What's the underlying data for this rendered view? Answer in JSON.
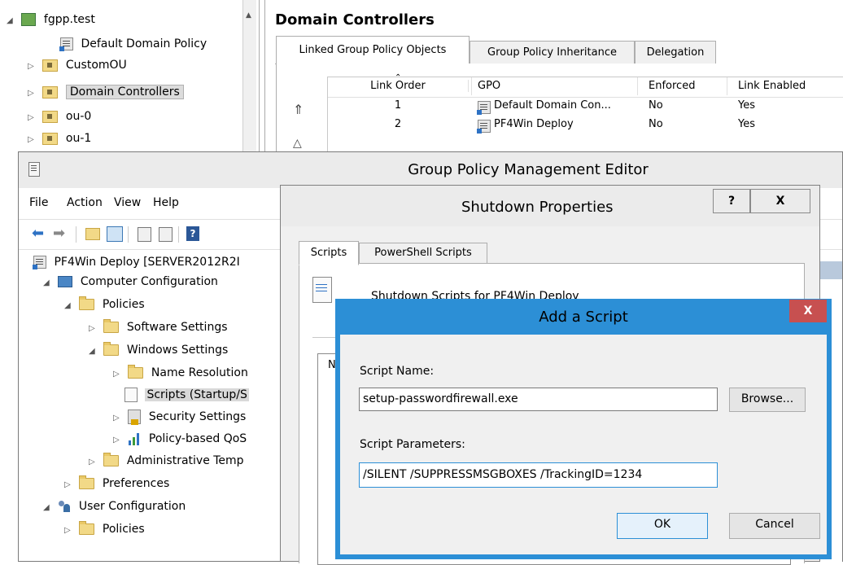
{
  "gpmc": {
    "tree": [
      {
        "label": "fgpp.test"
      },
      {
        "label": "Default Domain Policy"
      },
      {
        "label": "CustomOU"
      },
      {
        "label": "Domain Controllers"
      },
      {
        "label": "ou-0"
      },
      {
        "label": "ou-1"
      }
    ],
    "panel_title": "Domain Controllers",
    "tabs": [
      "Linked Group Policy Objects",
      "Group Policy Inheritance",
      "Delegation"
    ],
    "table": {
      "columns": [
        "Link Order",
        "GPO",
        "Enforced",
        "Link Enabled"
      ],
      "rows": [
        {
          "order": "1",
          "gpo": "Default Domain Con...",
          "enforced": "No",
          "enabled": "Yes"
        },
        {
          "order": "2",
          "gpo": "PF4Win Deploy",
          "enforced": "No",
          "enabled": "Yes"
        }
      ]
    }
  },
  "editor": {
    "title": "Group Policy Management Editor",
    "menu": [
      "File",
      "Action",
      "View",
      "Help"
    ],
    "tree": [
      {
        "label": "PF4Win Deploy [SERVER2012R2I"
      },
      {
        "label": "Computer Configuration"
      },
      {
        "label": "Policies"
      },
      {
        "label": "Software Settings"
      },
      {
        "label": "Windows Settings"
      },
      {
        "label": "Name Resolution"
      },
      {
        "label": "Scripts (Startup/S"
      },
      {
        "label": "Security Settings"
      },
      {
        "label": "Policy-based QoS"
      },
      {
        "label": "Administrative Temp"
      },
      {
        "label": "Preferences"
      },
      {
        "label": "User Configuration"
      },
      {
        "label": "Policies"
      }
    ]
  },
  "shutdown": {
    "title": "Shutdown Properties",
    "help_label": "?",
    "close_label": "X",
    "tabs": [
      "Scripts",
      "PowerShell Scripts"
    ],
    "heading_partial": "Shutdown Scripts for PF4Win Deploy",
    "list_col": "N"
  },
  "add_script": {
    "title": "Add a Script",
    "close_label": "X",
    "script_name_label": "Script Name:",
    "script_name_value": "setup-passwordfirewall.exe",
    "browse_label": "Browse...",
    "script_params_label": "Script Parameters:",
    "script_params_value": "/SILENT /SUPPRESSMSGBOXES /TrackingID=1234",
    "ok_label": "OK",
    "cancel_label": "Cancel"
  },
  "colors": {
    "close_red": "#c75050",
    "dialog_border": "#2c8fd6",
    "title_bg": "#ebebeb",
    "selected_bg": "#cce8ff"
  }
}
